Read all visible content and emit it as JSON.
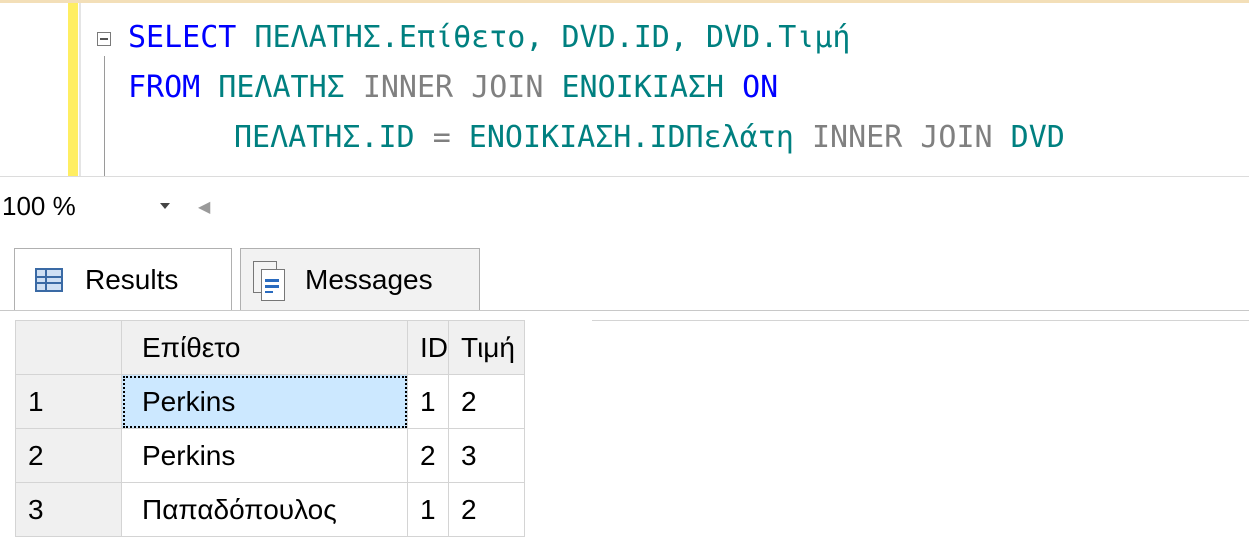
{
  "editor": {
    "line1": {
      "keyword": "SELECT",
      "rest": " ΠΕΛΑΤΗΣ.Επίθετο, DVD.ID, DVD.Τιμή"
    },
    "line2": {
      "kw_from": "FROM",
      "rest_a": " ΠΕΛΑΤΗΣ ",
      "kw_inner": "INNER",
      "sp1": " ",
      "kw_join": "JOIN",
      "rest_b": " ΕΝΟΙΚΙΑΣΗ ",
      "kw_on": "ON"
    },
    "line3": {
      "rest_a": "ΠΕΛΑΤΗΣ.ID ",
      "op_eq": "=",
      "rest_b": " ΕΝΟΙΚΙΑΣΗ.IDΠελάτη ",
      "kw_inner": "INNER",
      "sp1": " ",
      "kw_join": "JOIN",
      "rest_c": " DVD"
    }
  },
  "status": {
    "zoom": "100 %"
  },
  "tabs": {
    "results_label": "Results",
    "messages_label": "Messages"
  },
  "results": {
    "columns": [
      "Επίθετο",
      "ID",
      "Τιμή"
    ],
    "rows": [
      {
        "num": "1",
        "surname": "Perkins",
        "id": "1",
        "price": "2"
      },
      {
        "num": "2",
        "surname": "Perkins",
        "id": "2",
        "price": "3"
      },
      {
        "num": "3",
        "surname": "Παπαδόπουλος",
        "id": "1",
        "price": "2"
      }
    ]
  },
  "colors": {
    "keyword": "#0000ff",
    "identifier": "#008080",
    "selected_cell": "#cce8ff",
    "change_marker": "#ffee62"
  },
  "icons": [
    "collapse-icon",
    "zoom-dropdown-icon",
    "scroll-left-icon",
    "grid-icon",
    "messages-icon"
  ]
}
